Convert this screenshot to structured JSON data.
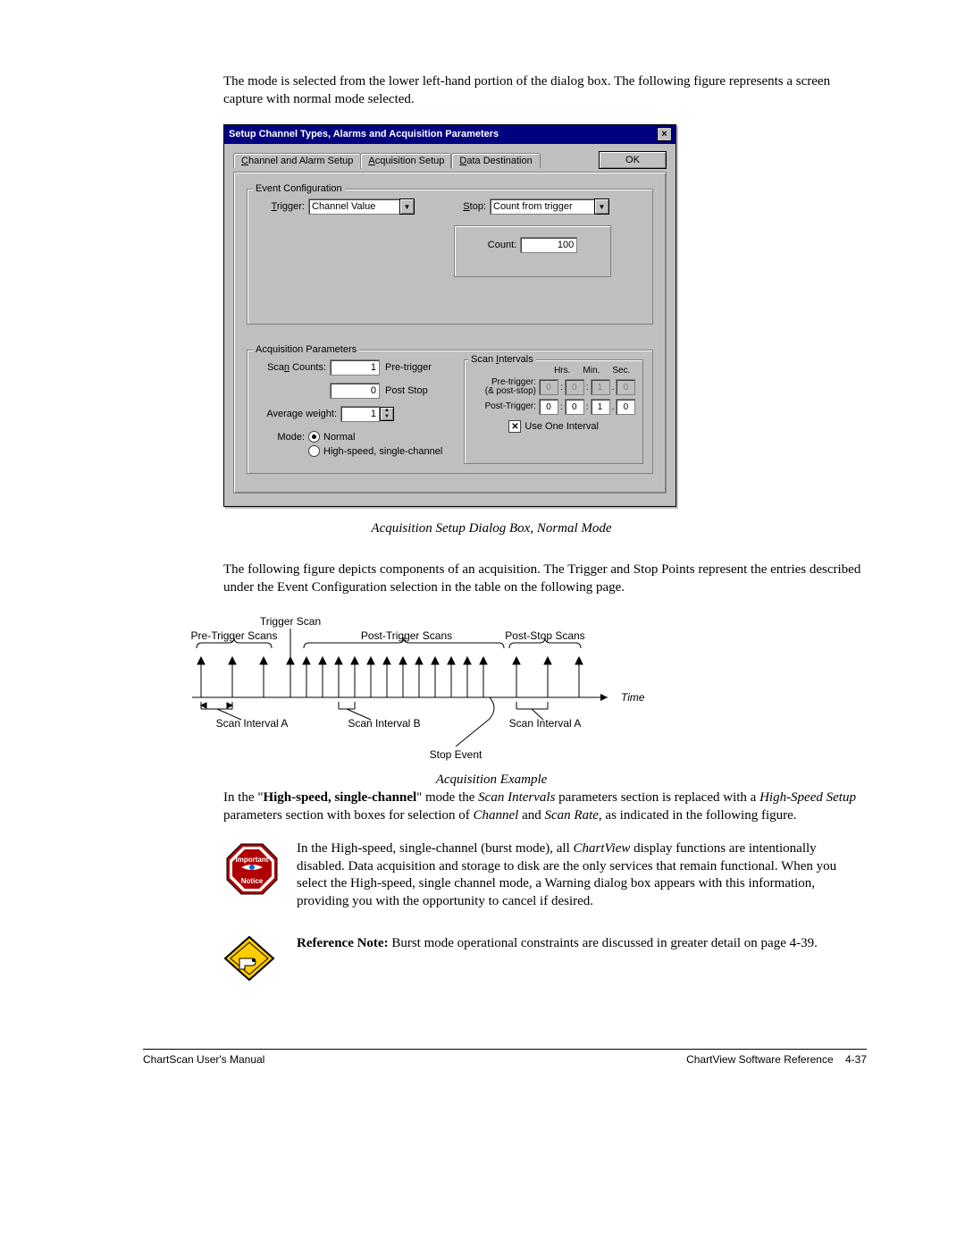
{
  "intro": "The mode is selected from the lower left-hand portion of the dialog box.  The following figure represents a screen capture with normal mode selected.",
  "dialog": {
    "title": "Setup Channel Types, Alarms and Acquisition Parameters",
    "close_glyph": "×",
    "ok_label": "OK",
    "tabs": {
      "channel": "Channel and Alarm Setup",
      "acq": "Acquisition Setup",
      "data": "Data Destination"
    },
    "event_cfg": {
      "legend": "Event Configuration",
      "trigger_label": "Trigger:",
      "trigger_value": "Channel Value",
      "stop_label": "Stop:",
      "stop_value": "Count from trigger",
      "count_label": "Count:",
      "count_value": "100"
    },
    "acq_params": {
      "legend": "Acquisition Parameters",
      "scan_counts_label": "Scan Counts:",
      "scan_counts_pre_value": "1",
      "scan_counts_pre_suffix": "Pre-trigger",
      "scan_counts_post_value": "0",
      "scan_counts_post_suffix": "Post Stop",
      "avg_weight_label": "Average weight:",
      "avg_weight_value": "1",
      "mode_label": "Mode:",
      "mode_normal": "Normal",
      "mode_high": "High-speed, single-channel",
      "scan_intervals": {
        "legend": "Scan Intervals",
        "hdr_hrs": "Hrs.",
        "hdr_min": "Min.",
        "hdr_sec": "Sec.",
        "pre_label_1": "Pre-trigger:",
        "pre_label_2": "(& post-stop)",
        "pre_h": "0",
        "pre_m": "0",
        "pre_s": "1",
        "pre_f": "0",
        "post_label": "Post-Trigger:",
        "post_h": "0",
        "post_m": "0",
        "post_s": "1",
        "post_f": "0",
        "use_one": "Use One Interval"
      }
    }
  },
  "caption1": "Acquisition Setup Dialog Box, Normal Mode",
  "para2": "The following figure depicts components of an acquisition.  The Trigger and Stop Points represent the entries described under the Event Configuration selection in the table on the following page.",
  "diagram": {
    "trigger_scan": "Trigger Scan",
    "pre_trigger_scans": "Pre-Trigger Scans",
    "post_trigger_scans": "Post-Trigger Scans",
    "post_stop_scans": "Post-Stop Scans",
    "stop_event": "Stop Event",
    "time": "Time",
    "sia": "Scan Interval A",
    "sib": "Scan Interval B"
  },
  "caption2": "Acquisition Example",
  "para3_a": "In the \"",
  "para3_b": "High-speed, single-channel",
  "para3_c": "\" mode the ",
  "para3_d": "Scan Intervals",
  "para3_e": " parameters section is replaced with a ",
  "para3_f": "High-Speed Setup",
  "para3_g": " parameters section with boxes for selection of ",
  "para3_h": "Channel",
  "para3_i": " and ",
  "para3_j": "Scan Rate,",
  "para3_k": " as indicated in the following figure.",
  "note1_a": "In the High-speed, single-channel (burst mode), all ",
  "note1_b": "ChartView",
  "note1_c": " display functions are intentionally disabled.  Data acquisition and storage to disk are the only services that remain functional.  When you select the High-speed, single channel mode, a Warning dialog box appears with this information, providing you with the opportunity to cancel if desired.",
  "note2_a": "Reference Note:",
  "note2_b": "  Burst mode operational constraints are discussed in greater detail on page 4-39.",
  "footer_left": "ChartScan User's Manual",
  "footer_right_a": "ChartView Software Reference",
  "footer_right_b": "4-37",
  "icon_labels": {
    "important": "Important",
    "notice": "Notice"
  }
}
